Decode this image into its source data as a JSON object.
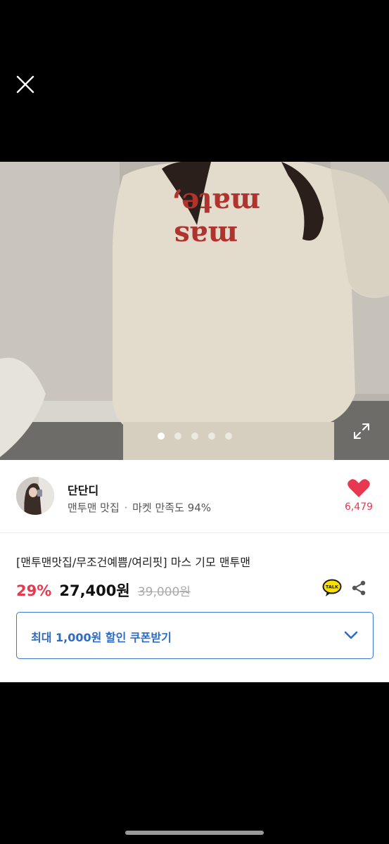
{
  "viewer": {
    "close_icon": "close-icon",
    "expand_icon": "expand-icon",
    "image_count": 5,
    "active_index": 0,
    "image_text_line1": "mate,",
    "image_text_line2": "mas"
  },
  "seller": {
    "name": "단단디",
    "store": "맨투맨 맛집",
    "separator": "·",
    "satisfaction": "마켓 만족도 94%",
    "like_count": "6,479",
    "like_color": "#e8384f"
  },
  "product": {
    "title": "[맨투맨맛집/무조건예쁨/여리핏] 마스 기모 맨투맨",
    "discount": "29%",
    "price": "27,400원",
    "original_price": "39,000원",
    "talk_label": "TALK"
  },
  "coupon": {
    "label": "최대 1,000원 할인 쿠폰받기",
    "accent": "#2d6bc5"
  }
}
